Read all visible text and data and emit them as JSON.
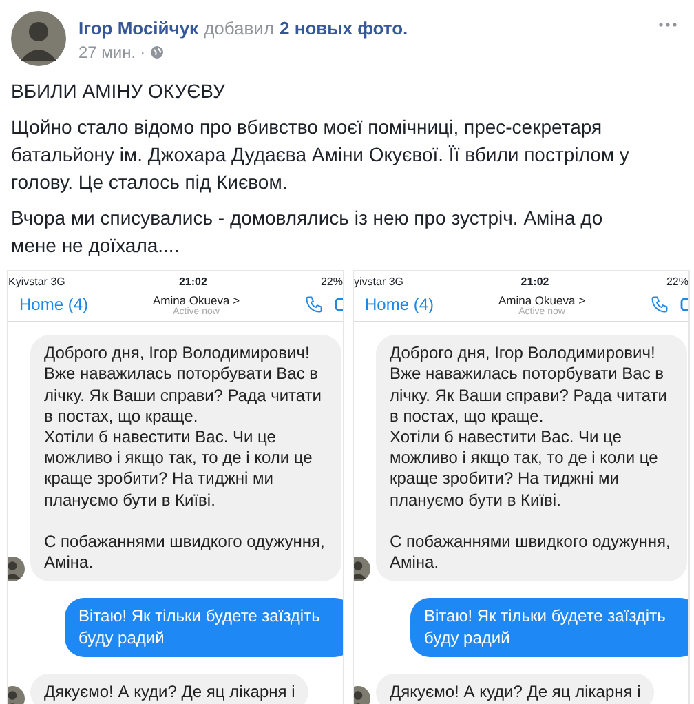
{
  "post": {
    "author": "Ігор Мосійчук",
    "action": "добавил",
    "photos_link": "2 новых фото.",
    "time": "27 мин.",
    "separator": "·",
    "title": "ВБИЛИ АМІНУ ОКУЄВУ",
    "paragraphs": [
      "Щойно стало відомо про вбивство моєї помічниці, прес-секретаря батальйону ім. Джохара Дудаєва Аміни Окуєвої. Її вбили пострілом у голову. Це сталось під Києвом.",
      "Вчора ми списувались - домовлялись із нею про зустріч. Аміна до мене не доїхала...."
    ]
  },
  "photos": [
    {
      "status_bar": {
        "carrier": "Kyivstar",
        "network": "3G",
        "time": "21:02",
        "battery": "22%"
      },
      "nav": {
        "back": "Home (4)",
        "contact": "Amina Okueva >",
        "presence": "Active now"
      },
      "messages": [
        {
          "kind": "incoming",
          "avatar": true,
          "text": "Доброго дня, Ігор Володимирович! Вже наважилась поторбувати Вас в лічку. Як Ваши справи? Рада читати в постах, що краще.\nХотіли б навестити Вас. Чи це можливо і якщо так, то де і коли це краще зробити? На тиджні ми плануємо бути в Київі.\n\nС побажаннями швидкого одужуння, Аміна."
        },
        {
          "kind": "outgoing",
          "avatar": false,
          "text": "Вітаю! Як тільки будете заїздіть буду радий"
        },
        {
          "kind": "incoming",
          "avatar": true,
          "text": "Дякуємо! А куди? Де яц лікарня і"
        }
      ]
    },
    {
      "status_bar": {
        "carrier": "yivstar",
        "network": "3G",
        "time": "21:02",
        "battery": "22%"
      },
      "nav": {
        "back": "Home (4)",
        "contact": "Amina Okueva >",
        "presence": "Active now"
      },
      "messages": [
        {
          "kind": "incoming",
          "avatar": true,
          "text": "Доброго дня, Ігор Володимирович! Вже наважилась поторбувати Вас в лічку. Як Ваши справи? Рада читати в постах, що краще.\nХотіли б навестити Вас. Чи це можливо і якщо так, то де і коли це краще зробити? На тиджні ми плануємо бути в Київі.\n\nС побажаннями швидкого одужуння, Аміна."
        },
        {
          "kind": "outgoing",
          "avatar": false,
          "text": "Вітаю! Як тільки будете заїздіть буду радий"
        },
        {
          "kind": "incoming",
          "avatar": true,
          "text": "Дякуємо! А куди? Де яц лікарня і"
        }
      ]
    }
  ]
}
